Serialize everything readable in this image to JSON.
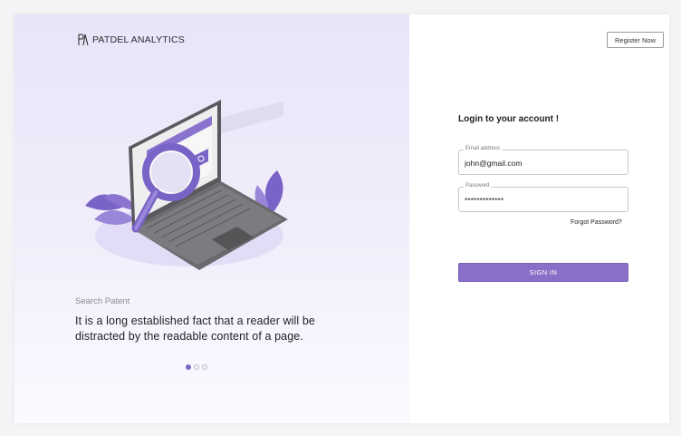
{
  "brand": {
    "name": "PATDEL ANALYTICS",
    "logo_icon": "pa-logo-icon"
  },
  "hero": {
    "label": "Search Patent",
    "text": "It is a long established fact that a reader will be distracted by the readable content of a page.",
    "slides": {
      "total": 3,
      "active": 1
    }
  },
  "header": {
    "register_label": "Register Now"
  },
  "login": {
    "title": "Login to your account !",
    "email": {
      "label": "Email address",
      "value": "john@gmail.com"
    },
    "password": {
      "label": "Password",
      "value": "*************"
    },
    "forgot_label": "Forgot Password?",
    "submit_label": "SIGN IN"
  },
  "colors": {
    "accent": "#8a6fc8",
    "hero_bg": "#ece8f9"
  }
}
